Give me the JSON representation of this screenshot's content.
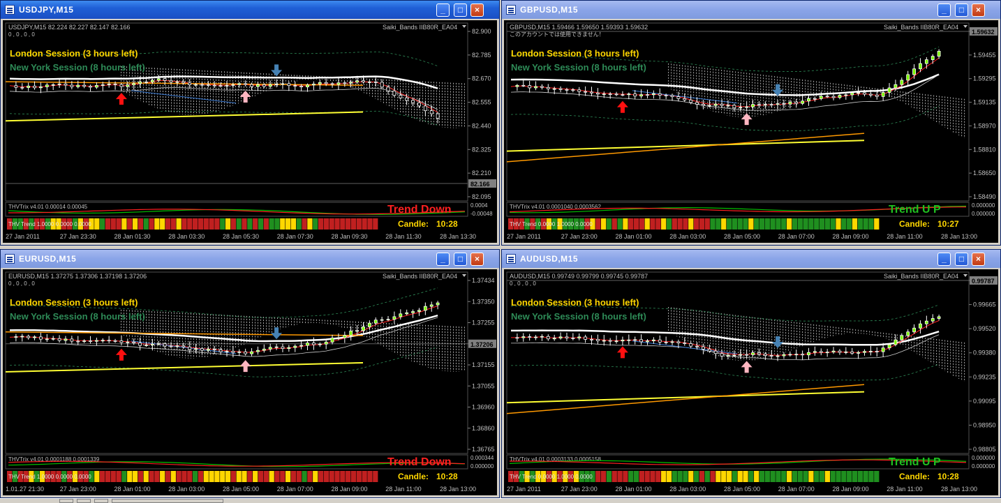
{
  "colors": {
    "accent": "#1f5fd6",
    "session_london": "#ffd700",
    "session_newyork": "#2e8b57",
    "trend_down": "#ff2020",
    "trend_up": "#20c020",
    "candle_bull": "#ffffff",
    "candle_bull_body": "#7cfc00",
    "candle_bear": "#ffffff",
    "grid": "#303030",
    "price_axis_text": "#c0c0c0"
  },
  "windows": [
    {
      "title": "USDJPY,M15",
      "ohlc_line": "USDJPY,M15  82.224 82.227 82.147 82.166",
      "sub_line": "0 , 0 , 0 , 0",
      "indicator_label": "Saiki_Bands IIB80R_EA04",
      "london_session": "London Session (3 hours left)",
      "newyork_session": "New York Session (8 hours left)",
      "price_ticks": [
        "82.900",
        "82.785",
        "82.670",
        "82.555",
        "82.440",
        "82.325",
        "82.210",
        "82.095"
      ],
      "current_price": "82.166",
      "trix_label": "THVTrix v4.01 0.00014 0.00045",
      "trix_ticks": [
        "0.0004",
        "-0.00048"
      ],
      "trend_text": "Trend Down",
      "trend_direction": "down",
      "heat_label": "THV Trend 1.0000 0.0000 0.0000",
      "candle_label": "Candle:",
      "candle_timer": "10:28",
      "time_ticks": [
        "27 Jan 2011",
        "27 Jan 23:30",
        "28 Jan 01:30",
        "28 Jan 03:30",
        "28 Jan 05:30",
        "28 Jan 07:30",
        "28 Jan 09:30",
        "28 Jan 11:30",
        "28 Jan 13:30"
      ],
      "active": true
    },
    {
      "title": "GBPUSD,M15",
      "ohlc_line": "GBPUSD,M15  1.59466 1.59650 1.59393 1.59632",
      "sub_line": "このアカウントでは使用できません！",
      "indicator_label": "Saiki_Bands IIB80R_EA04",
      "london_session": "London Session (3 hours left)",
      "newyork_session": "New York Session (8 hours left)",
      "price_ticks": [
        "1.59632",
        "1.59455",
        "1.59295",
        "1.59135",
        "1.58970",
        "1.58810",
        "1.58650",
        "1.58490"
      ],
      "current_price": "1.59632",
      "trix_label": "THVTrix v4.01 0.0001040 0.0003562",
      "trix_ticks": [
        "0.000000",
        "0.000000"
      ],
      "trend_text": "Trend U P",
      "trend_direction": "up",
      "heat_label": "THV Trend 0.0000 1.0000 0.0000",
      "candle_label": "Candle:",
      "candle_timer": "10:27",
      "time_ticks": [
        "27 Jan 2011",
        "27 Jan 23:00",
        "28 Jan 01:00",
        "28 Jan 03:00",
        "28 Jan 05:00",
        "28 Jan 07:00",
        "28 Jan 09:00",
        "28 Jan 11:00",
        "28 Jan 13:00"
      ],
      "active": false
    },
    {
      "title": "EURUSD,M15",
      "ohlc_line": "EURUSD,M15  1.37275 1.37306 1.37198 1.37206",
      "sub_line": "0 , 0 , 0 , 0",
      "indicator_label": "Saiki_Bands IIB80R_EA04",
      "london_session": "London Session (3 hours left)",
      "newyork_session": "New York Session (8 hours left)",
      "price_ticks": [
        "1.37434",
        "1.37350",
        "1.37255",
        "1.37206",
        "1.37155",
        "1.37055",
        "1.36960",
        "1.36860",
        "1.36765"
      ],
      "current_price": "1.37206",
      "trix_label": "THVTrix v4.01 0.0001188 0.0001339",
      "trix_ticks": [
        "0.000344",
        "0.000000"
      ],
      "trend_text": "Trend Down",
      "trend_direction": "down",
      "heat_label": "THV Trend 1.0000 0.0000 0.0000",
      "candle_label": "Candle:",
      "candle_timer": "10:28",
      "time_ticks": [
        "1.01.27 21:30",
        "27 Jan 23:00",
        "28 Jan 01:00",
        "28 Jan 03:00",
        "28 Jan 05:00",
        "28 Jan 07:00",
        "28 Jan 09:00",
        "28 Jan 11:00",
        "28 Jan 13:00"
      ],
      "active": false
    },
    {
      "title": "AUDUSD,M15",
      "ohlc_line": "AUDUSD,M15  0.99749 0.99799 0.99745 0.99787",
      "sub_line": "0 , 0 , 0 , 0",
      "indicator_label": "Saiki_Bands IIB80R_EA04",
      "london_session": "London Session (3 hours left)",
      "newyork_session": "New York Session (8 hours left)",
      "price_ticks": [
        "0.99787",
        "0.99665",
        "0.99520",
        "0.99380",
        "0.99235",
        "0.99095",
        "0.98950",
        "0.98805"
      ],
      "current_price": "0.99787",
      "trix_label": "THVTrix v4.01 0.0003133 0.0005158",
      "trix_ticks": [
        "0.000000",
        "0.000000"
      ],
      "trend_text": "Trend U P",
      "trend_direction": "up",
      "heat_label": "THV Trend 0.0000 1.0000 0.0000",
      "candle_label": "Candle:",
      "candle_timer": "10:28",
      "time_ticks": [
        "27 Jan 2011",
        "27 Jan 23:00",
        "28 Jan 01:00",
        "28 Jan 03:00",
        "28 Jan 05:00",
        "28 Jan 07:00",
        "28 Jan 09:00",
        "28 Jan 11:00",
        "28 Jan 13:00"
      ],
      "active": false
    }
  ],
  "window_buttons": {
    "minimize": "_",
    "maximize": "□",
    "close": "×"
  }
}
